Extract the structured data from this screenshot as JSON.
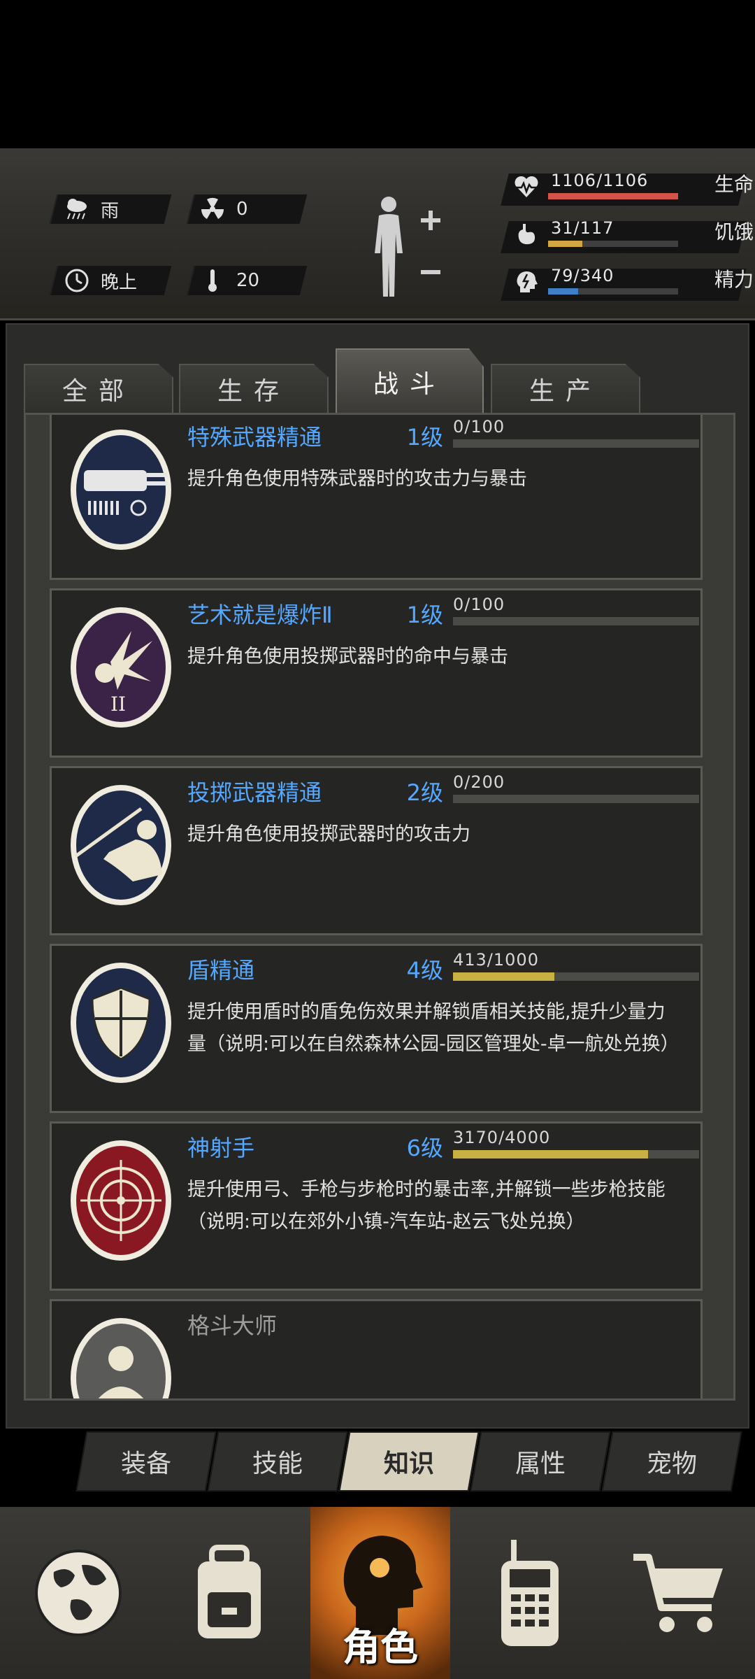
{
  "status": {
    "weather": "雨",
    "radiation": "0",
    "time_of_day": "晚上",
    "temperature": "20",
    "stats": [
      {
        "name": "生命",
        "value": "1106/1106",
        "current": 1106,
        "max": 1106,
        "color": "#d4534a",
        "icon": "heart-pulse-icon"
      },
      {
        "name": "饥饿",
        "value": "31/117",
        "current": 31,
        "max": 117,
        "color": "#d2a640",
        "icon": "stomach-icon"
      },
      {
        "name": "精力",
        "value": "79/340",
        "current": 79,
        "max": 340,
        "color": "#3f7fc8",
        "icon": "brain-head-icon"
      }
    ]
  },
  "tabs": [
    {
      "label": "全部",
      "active": false
    },
    {
      "label": "生存",
      "active": false
    },
    {
      "label": "战斗",
      "active": true
    },
    {
      "label": "生产",
      "active": false
    }
  ],
  "skills": [
    {
      "title": "特殊武器精通",
      "level": "1级",
      "progress": "0/100",
      "fraction": 0.0,
      "desc": "提升角色使用特殊武器时的攻击力与暴击",
      "icon": "gatling-gun-icon"
    },
    {
      "title": "艺术就是爆炸Ⅱ",
      "level": "1级",
      "progress": "0/100",
      "fraction": 0.0,
      "desc": "提升角色使用投掷武器时的命中与暴击",
      "icon": "explosion-icon"
    },
    {
      "title": "投掷武器精通",
      "level": "2级",
      "progress": "0/200",
      "fraction": 0.0,
      "desc": "提升角色使用投掷武器时的攻击力",
      "icon": "javelin-thrower-icon"
    },
    {
      "title": "盾精通",
      "level": "4级",
      "progress": "413/1000",
      "fraction": 0.413,
      "desc": "提升使用盾时的盾免伤效果并解锁盾相关技能,提升少量力量（说明:可以在自然森林公园-园区管理处-卓一航处兑换）",
      "icon": "shield-icon"
    },
    {
      "title": "神射手",
      "level": "6级",
      "progress": "3170/4000",
      "fraction": 0.7925,
      "desc": "提升使用弓、手枪与步枪时的暴击率,并解锁一些步枪技能（说明:可以在郊外小镇-汽车站-赵云飞处兑换）",
      "icon": "crosshair-target-icon"
    },
    {
      "title": "格斗大师",
      "icon": "fighter-icon"
    }
  ],
  "subnav": [
    {
      "label": "装备",
      "active": false
    },
    {
      "label": "技能",
      "active": false
    },
    {
      "label": "知识",
      "active": true
    },
    {
      "label": "属性",
      "active": false
    },
    {
      "label": "宠物",
      "active": false
    }
  ],
  "bottom_nav": {
    "active_label": "角色",
    "items": [
      "globe-icon",
      "backpack-icon",
      "character-head-icon",
      "radio-icon",
      "shopping-cart-icon"
    ]
  }
}
